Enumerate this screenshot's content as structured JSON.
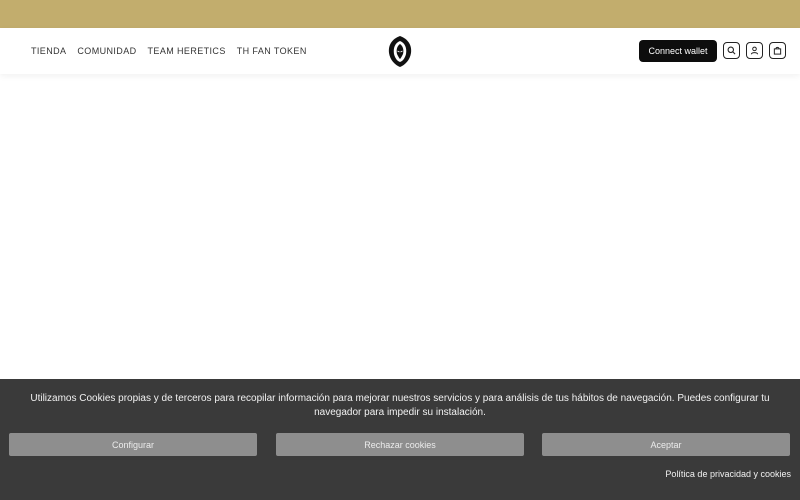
{
  "header": {
    "nav": [
      {
        "label": "TIENDA"
      },
      {
        "label": "COMUNIDAD"
      },
      {
        "label": "TEAM HERETICS"
      },
      {
        "label": "TH FAN TOKEN"
      }
    ],
    "logo_icon": "heretics-hooded-logo-icon",
    "connect_label": "Connect wallet",
    "icons": [
      "search-icon",
      "user-icon",
      "cart-icon"
    ]
  },
  "cookie": {
    "text": "Utilizamos Cookies propias y de terceros para recopilar información para mejorar nuestros servicios y para análisis de tus hábitos de navegación. Puedes configurar tu navegador para impedir su instalación.",
    "buttons": {
      "configure": "Configurar",
      "reject": "Rechazar cookies",
      "accept": "Aceptar"
    },
    "policy_link": "Política de privacidad y cookies"
  },
  "colors": {
    "banner": "#c2ad6d",
    "cookie_bg": "#3a3a3a",
    "cookie_button": "#8e8e8e",
    "connect_button": "#0d0d0d"
  }
}
